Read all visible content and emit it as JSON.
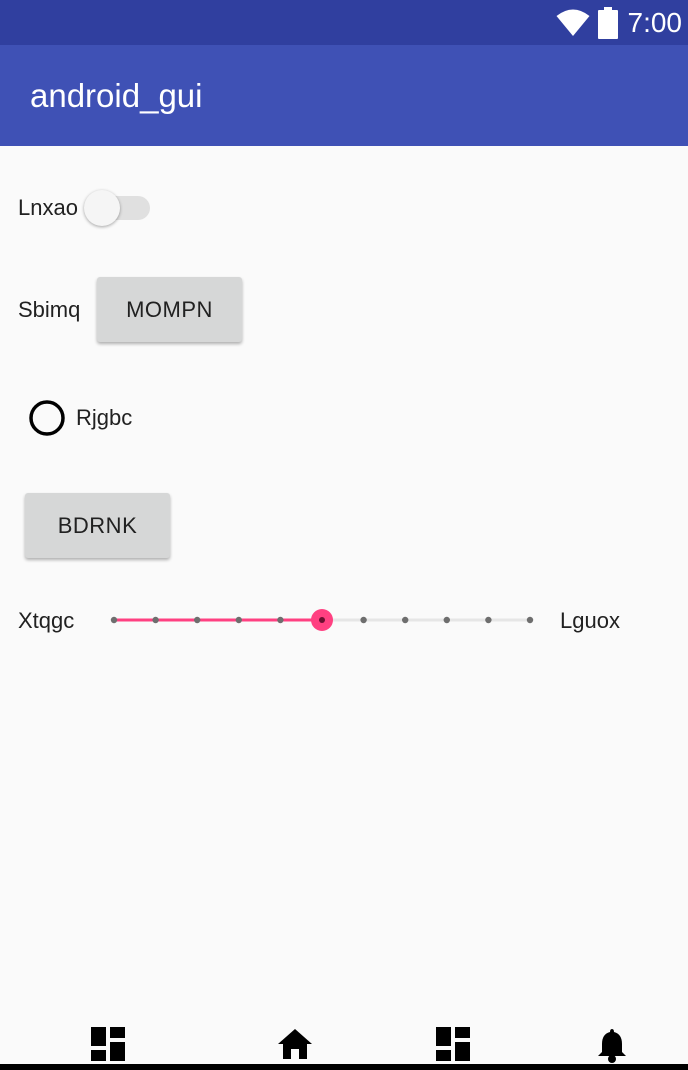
{
  "status_bar": {
    "time": "7:00",
    "icons": [
      "wifi-icon",
      "battery-icon"
    ],
    "background": "#303f9f"
  },
  "app_bar": {
    "title": "android_gui",
    "background": "#3f51b5"
  },
  "content": {
    "switch_row": {
      "label": "Lnxao",
      "checked": false
    },
    "button_row": {
      "label": "Sbimq",
      "button_label": "MOMPN"
    },
    "radio": {
      "label": "Rjgbc",
      "checked": false
    },
    "standalone_button": {
      "label": "BDRNK"
    },
    "slider": {
      "left_label": "Xtqgc",
      "right_label": "Lguox",
      "min": 0,
      "max": 10,
      "value": 5,
      "accent": "#ff4081"
    }
  },
  "nav_bar": {
    "icons": [
      "dashboard-icon",
      "home-icon",
      "dashboard-icon",
      "notification-bell-icon"
    ]
  }
}
